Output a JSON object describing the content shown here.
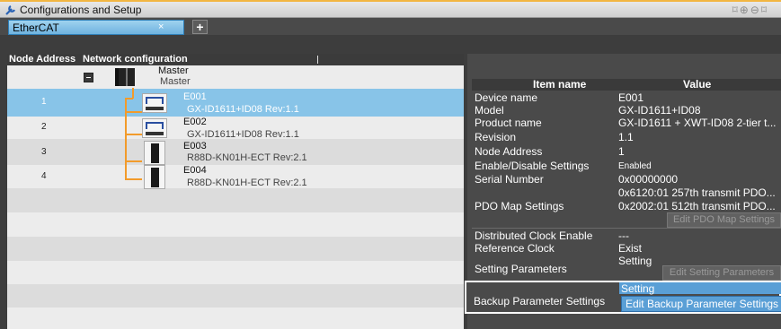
{
  "window": {
    "title": "Configurations and Setup"
  },
  "tab": {
    "label": "EtherCAT",
    "close": "×",
    "add": "+"
  },
  "tree_header": {
    "node_address": "Node Address",
    "network_config": "Network configuration"
  },
  "master": {
    "label": "Master",
    "sublabel": "Master"
  },
  "nodes": [
    {
      "address": "1",
      "name": "E001",
      "model": "GX-ID1611+ID08 Rev:1.1"
    },
    {
      "address": "2",
      "name": "E002",
      "model": "GX-ID1611+ID08 Rev:1.1"
    },
    {
      "address": "3",
      "name": "E003",
      "model": "R88D-KN01H-ECT Rev:2.1"
    },
    {
      "address": "4",
      "name": "E004",
      "model": "R88D-KN01H-ECT Rev:2.1"
    }
  ],
  "props": {
    "header_item": "Item name",
    "header_value": "Value",
    "device_name": {
      "k": "Device name",
      "v": "E001"
    },
    "model": {
      "k": "Model",
      "v": "GX-ID1611+ID08"
    },
    "product_name": {
      "k": "Product name",
      "v": "GX-ID1611 + XWT-ID08 2-tier t..."
    },
    "revision": {
      "k": "Revision",
      "v": "1.1"
    },
    "node_address": {
      "k": "Node Address",
      "v": "1"
    },
    "enable_disable": {
      "k": "Enable/Disable Settings",
      "v": "Enabled"
    },
    "serial": {
      "k": "Serial Number",
      "v": "0x00000000"
    },
    "pdo_map": {
      "k": "PDO Map Settings",
      "v1": "0x6120:01 257th transmit PDO...",
      "v2": "0x2002:01 512th transmit PDO...",
      "btn": "Edit PDO Map Settings"
    },
    "dist_clock": {
      "k": "Distributed Clock Enable",
      "v": "---"
    },
    "ref_clock": {
      "k": "Reference Clock",
      "v": "Exist"
    },
    "setting_params": {
      "k": "Setting Parameters",
      "v": "Setting",
      "btn": "Edit Setting Parameters"
    },
    "backup": {
      "k": "Backup Parameter Settings",
      "v": "Setting",
      "btn": "Edit Backup Parameter Settings"
    }
  },
  "colors": {
    "accent": "#f2b642",
    "selection": "#88c4e8",
    "button_blue": "#5a9fd6"
  }
}
